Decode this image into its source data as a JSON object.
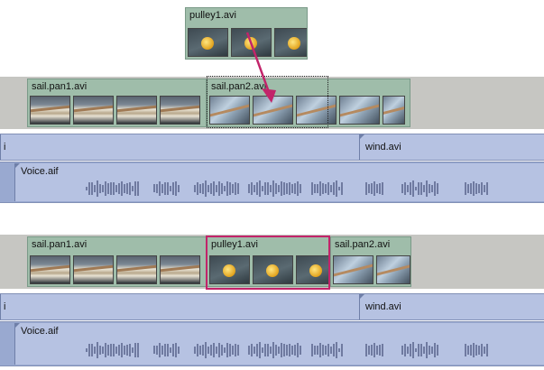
{
  "top_panel": {
    "floating_clip": {
      "label": "pulley1.avi"
    },
    "video_track": {
      "clips": [
        {
          "label": "sail.pan1.avi"
        },
        {
          "label": "sail.pan2.avi"
        }
      ]
    },
    "audio_track_1": {
      "left_clip_label": "i",
      "right_clip_label": "wind.avi"
    },
    "audio_track_2": {
      "clip_label": "Voice.aif"
    }
  },
  "bottom_panel": {
    "video_track": {
      "clips": [
        {
          "label": "sail.pan1.avi"
        },
        {
          "label": "pulley1.avi"
        },
        {
          "label": "sail.pan2.avi"
        }
      ]
    },
    "audio_track_1": {
      "left_clip_label": "i",
      "right_clip_label": "wind.avi"
    },
    "audio_track_2": {
      "clip_label": "Voice.aif"
    }
  },
  "colors": {
    "video_clip": "#9fbdaa",
    "audio_track": "#99a9d0",
    "audio_clip": "#b6c2e2",
    "highlight": "#c2246a",
    "drag_arrow": "#c2246a"
  },
  "icons": {
    "drag_arrow": "drag-arrow-icon",
    "waveform": "audio-waveform-icon"
  }
}
